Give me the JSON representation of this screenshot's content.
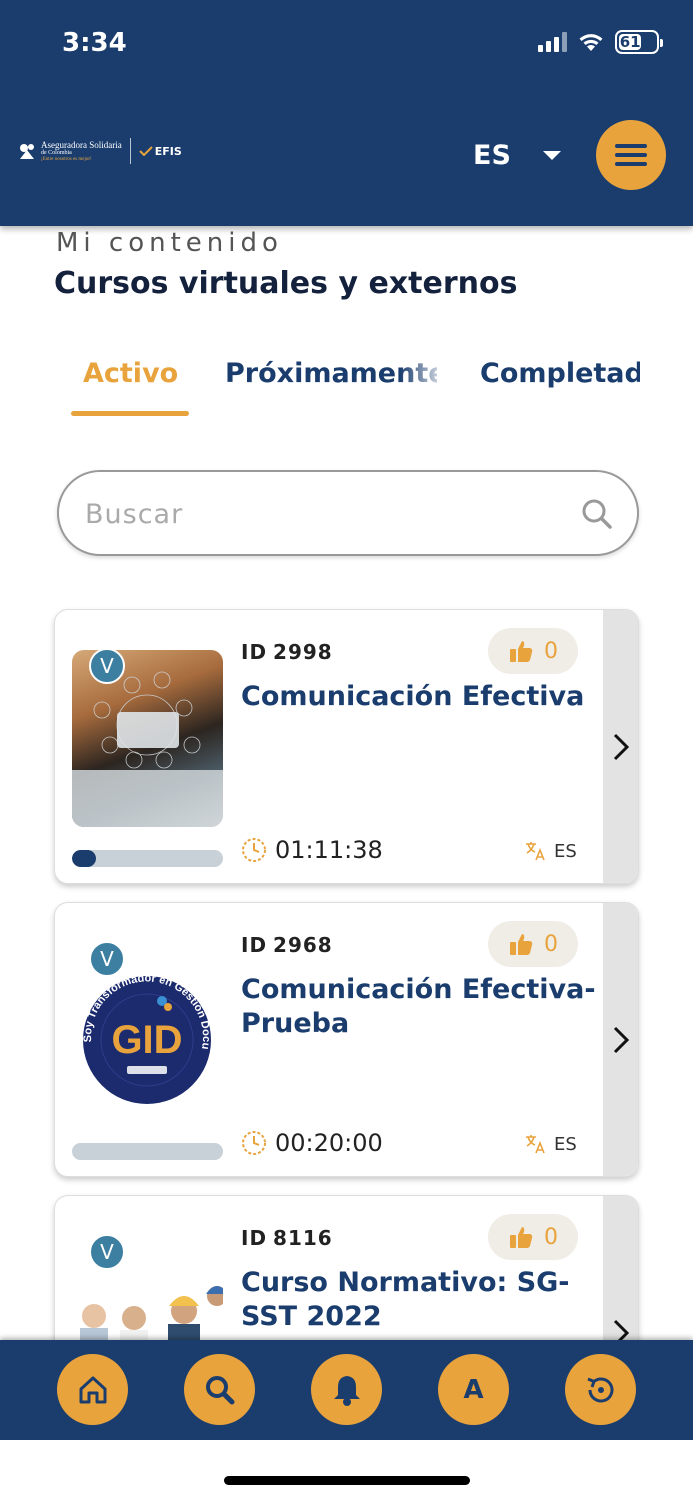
{
  "status_bar": {
    "time": "3:34",
    "battery": "61"
  },
  "header": {
    "logo_name": "Aseguradora Solidaria",
    "logo_sub": "de Colombia",
    "logo_tagline": "¡Entre nosotros es mejor!",
    "logo_partner": "EFIS",
    "language": "ES"
  },
  "section": {
    "subtitle": "Mi contenido",
    "title": "Cursos virtuales y externos"
  },
  "tabs": [
    {
      "label": "Activo"
    },
    {
      "label": "Próximamente"
    },
    {
      "label": "Completado"
    }
  ],
  "search": {
    "placeholder": "Buscar"
  },
  "courses": [
    {
      "id_label": "ID",
      "id": "2998",
      "likes": "0",
      "title": "Comunicación Efectiva",
      "badge": "V",
      "duration": "01:11:38",
      "lang": "ES",
      "progress": 0.16
    },
    {
      "id_label": "ID",
      "id": "2968",
      "likes": "0",
      "title": "Comunicación Efectiva- Prueba",
      "badge": "V",
      "duration": "00:20:00",
      "lang": "ES",
      "progress": 0,
      "thumb_text": "GID",
      "thumb_ring": "Soy Transformador en Gestión Documental"
    },
    {
      "id_label": "ID",
      "id": "8116",
      "likes": "0",
      "title": "Curso Normativo: SG-SST 2022",
      "badge": "V"
    }
  ],
  "bottom_nav": {
    "profile_letter": "A"
  },
  "colors": {
    "primary": "#1a3d6e",
    "accent": "#e8a33d"
  }
}
